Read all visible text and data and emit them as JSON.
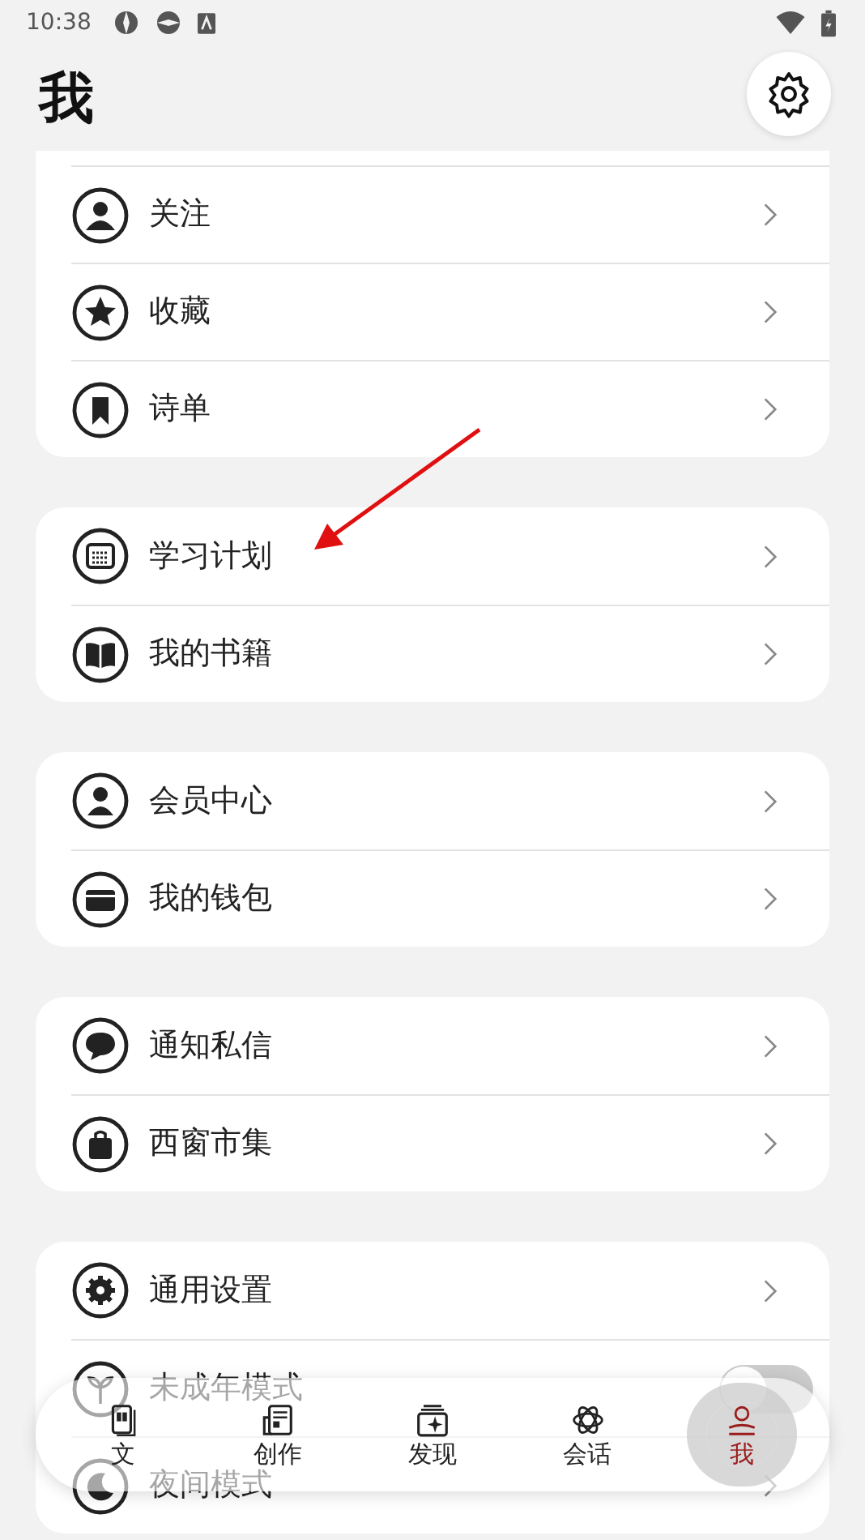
{
  "status_bar": {
    "time": "10:38"
  },
  "header": {
    "title": "我"
  },
  "sections": [
    {
      "rows": [
        {
          "label": "关注",
          "kind": "link"
        },
        {
          "label": "收藏",
          "kind": "link"
        },
        {
          "label": "诗单",
          "kind": "link"
        }
      ]
    },
    {
      "rows": [
        {
          "label": "学习计划",
          "kind": "link"
        },
        {
          "label": "我的书籍",
          "kind": "link"
        }
      ]
    },
    {
      "rows": [
        {
          "label": "会员中心",
          "kind": "link"
        },
        {
          "label": "我的钱包",
          "kind": "link"
        }
      ]
    },
    {
      "rows": [
        {
          "label": "通知私信",
          "kind": "link"
        },
        {
          "label": "西窗市集",
          "kind": "link"
        }
      ]
    },
    {
      "rows": [
        {
          "label": "通用设置",
          "kind": "link"
        },
        {
          "label": "未成年模式",
          "kind": "toggle",
          "on": false
        },
        {
          "label": "夜间模式",
          "kind": "link"
        }
      ]
    }
  ],
  "bottom_nav": [
    {
      "label": "文",
      "selected": false
    },
    {
      "label": "创作",
      "selected": false
    },
    {
      "label": "发现",
      "selected": false
    },
    {
      "label": "会话",
      "selected": false
    },
    {
      "label": "我",
      "selected": true
    }
  ]
}
